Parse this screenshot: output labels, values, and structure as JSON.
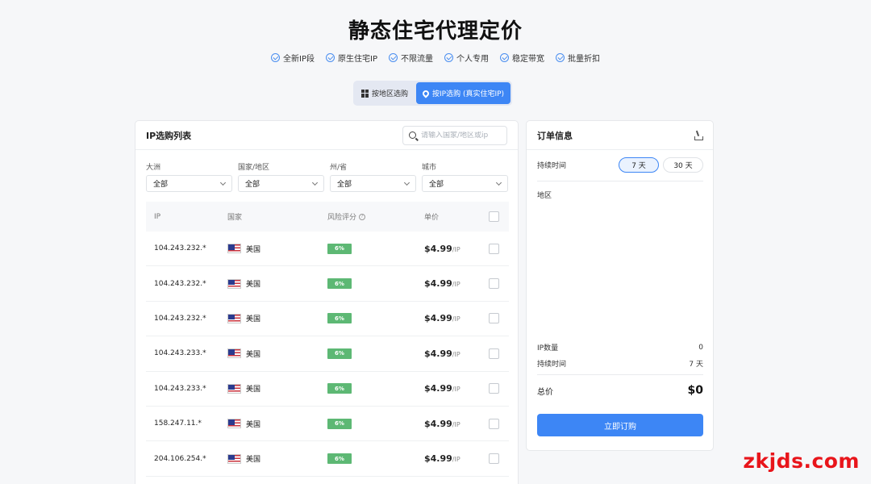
{
  "page": {
    "title": "静态住宅代理定价"
  },
  "features": [
    "全新IP段",
    "原生住宅IP",
    "不限流量",
    "个人专用",
    "稳定带宽",
    "批量折扣"
  ],
  "mode_switch": {
    "by_region": "按地区选购",
    "by_ip": "按IP选购 (真实住宅IP)"
  },
  "ip_list": {
    "title": "IP选购列表",
    "search_placeholder": "请输入国家/地区或ip",
    "filters": [
      {
        "label": "大洲",
        "value": "全部"
      },
      {
        "label": "国家/地区",
        "value": "全部"
      },
      {
        "label": "州/省",
        "value": "全部"
      },
      {
        "label": "城市",
        "value": "全部"
      }
    ],
    "columns": {
      "ip": "IP",
      "country": "国家",
      "risk": "风险评分",
      "price": "单价"
    },
    "rows": [
      {
        "ip": "104.243.232.*",
        "country": "美国",
        "risk": "6%",
        "price": "$4.99",
        "unit": "/IP"
      },
      {
        "ip": "104.243.232.*",
        "country": "美国",
        "risk": "6%",
        "price": "$4.99",
        "unit": "/IP"
      },
      {
        "ip": "104.243.232.*",
        "country": "美国",
        "risk": "6%",
        "price": "$4.99",
        "unit": "/IP"
      },
      {
        "ip": "104.243.233.*",
        "country": "美国",
        "risk": "6%",
        "price": "$4.99",
        "unit": "/IP"
      },
      {
        "ip": "104.243.233.*",
        "country": "美国",
        "risk": "6%",
        "price": "$4.99",
        "unit": "/IP"
      },
      {
        "ip": "158.247.11.*",
        "country": "美国",
        "risk": "6%",
        "price": "$4.99",
        "unit": "/IP"
      },
      {
        "ip": "204.106.254.*",
        "country": "美国",
        "risk": "6%",
        "price": "$4.99",
        "unit": "/IP"
      }
    ]
  },
  "order": {
    "title": "订单信息",
    "duration_label": "持续时间",
    "duration_options": [
      "7 天",
      "30 天"
    ],
    "region_label": "地区",
    "ip_count_label": "IP数量",
    "ip_count_value": "0",
    "duration_summary_label": "持续时间",
    "duration_summary_value": "7 天",
    "total_label": "总价",
    "total_value": "$0",
    "submit_label": "立即订购"
  },
  "watermark": "zkjds.com",
  "colors": {
    "accent": "#3d86f5",
    "risk_badge": "#5db874",
    "watermark": "#e8151b"
  }
}
